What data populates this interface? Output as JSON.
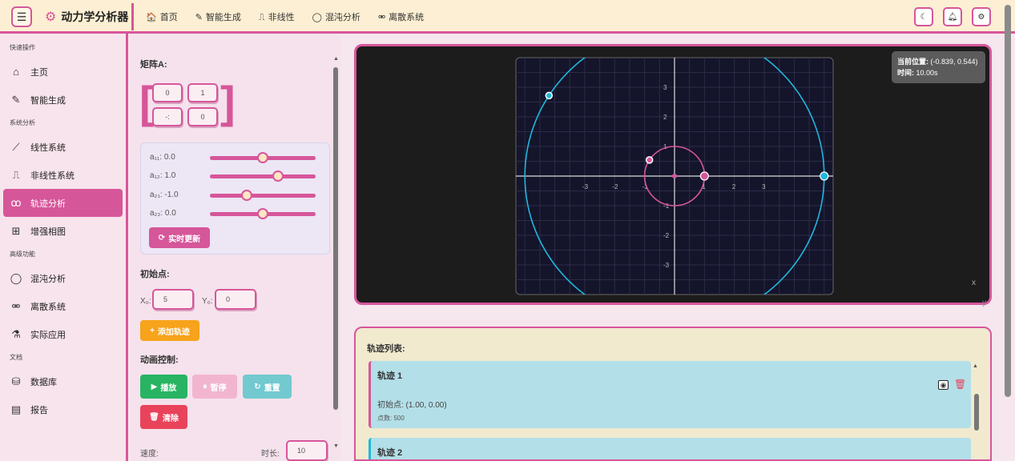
{
  "header": {
    "app_title": "动力学分析器",
    "nav": [
      {
        "label": "首页",
        "icon": "home-icon",
        "glyph": "🏠"
      },
      {
        "label": "智能生成",
        "icon": "pencil-icon",
        "glyph": "✎"
      },
      {
        "label": "非线性",
        "icon": "wave-icon",
        "glyph": "⎍"
      },
      {
        "label": "混沌分析",
        "icon": "circle-icon",
        "glyph": "◯"
      },
      {
        "label": "离散系统",
        "icon": "nodes-icon",
        "glyph": "⚮"
      }
    ]
  },
  "sidebar": {
    "sections": [
      {
        "title": "快速操作",
        "items": [
          {
            "label": "主页",
            "icon": "home-icon",
            "glyph": "⌂"
          },
          {
            "label": "智能生成",
            "icon": "pencil-icon",
            "glyph": "✎"
          }
        ]
      },
      {
        "title": "系统分析",
        "items": [
          {
            "label": "线性系统",
            "icon": "chart-line-icon",
            "glyph": "⟋"
          },
          {
            "label": "非线性系统",
            "icon": "wave-icon",
            "glyph": "⎍"
          },
          {
            "label": "轨迹分析",
            "icon": "route-icon",
            "glyph": "ꝏ",
            "active": true
          },
          {
            "label": "增强相图",
            "icon": "grid-icon",
            "glyph": "⊞"
          }
        ]
      },
      {
        "title": "高级功能",
        "items": [
          {
            "label": "混沌分析",
            "icon": "circle-icon",
            "glyph": "◯"
          },
          {
            "label": "离散系统",
            "icon": "nodes-icon",
            "glyph": "⚮"
          },
          {
            "label": "实际应用",
            "icon": "flask-icon",
            "glyph": "⚗"
          }
        ]
      },
      {
        "title": "文档",
        "items": [
          {
            "label": "数据库",
            "icon": "database-icon",
            "glyph": "⛁"
          },
          {
            "label": "报告",
            "icon": "file-icon",
            "glyph": "▤"
          }
        ]
      }
    ]
  },
  "controls": {
    "matrix_label": "矩阵A:",
    "matrix": [
      "0",
      "1",
      "-:",
      "0"
    ],
    "sliders": [
      {
        "label": "a₁₁: 0.0",
        "value": 0.0
      },
      {
        "label": "a₁₂: 1.0",
        "value": 1.0
      },
      {
        "label": "a₂₁: -1.0",
        "value": -1.0
      },
      {
        "label": "a₂₂: 0.0",
        "value": 0.0
      }
    ],
    "realtime_button": "实时更新",
    "initial_label": "初始点:",
    "x0_label": "X₀:",
    "x0_value": "5",
    "y0_label": "Y₀:",
    "y0_value": "0",
    "add_button": "添加轨迹",
    "anim_label": "动画控制:",
    "play": "播放",
    "pause": "暂停",
    "reset": "重置",
    "clear": "清除",
    "speed_label": "速度:",
    "duration_label": "时长:",
    "duration_value": "10"
  },
  "plot": {
    "tooltip_pos_label": "当前位置:",
    "tooltip_pos_value": "(-0.839, 0.544)",
    "tooltip_time_label": "时间:",
    "tooltip_time_value": "10.00s",
    "x_axis_letter": "x",
    "y_axis_letter": "y",
    "colors": {
      "trajectory1": "#d6569a",
      "trajectory2": "#1fb8dd",
      "plot_bg": "#14142b"
    }
  },
  "chart_data": {
    "type": "line",
    "xlim": [
      -5.3,
      5.3
    ],
    "ylim": [
      -4,
      4
    ],
    "x_ticks": [
      "-3",
      "-2",
      "-1",
      "1",
      "2",
      "3"
    ],
    "y_ticks": [
      "3",
      "2",
      "1",
      "-1",
      "-2",
      "-3"
    ],
    "grid": true,
    "series": [
      {
        "radius": 1,
        "start": [
          1,
          0
        ],
        "current": [
          -0.839,
          0.544
        ],
        "color": "#d6569a"
      },
      {
        "radius": 5,
        "start": [
          5,
          0
        ],
        "current": [
          -4.195,
          2.72
        ],
        "color": "#1fb8dd"
      }
    ]
  },
  "trajectory_list": {
    "title": "轨迹列表:",
    "items": [
      {
        "name": "轨迹 1",
        "initial": "初始点: (1.00, 0.00)",
        "points": "点数: 500"
      },
      {
        "name": "轨迹 2"
      }
    ]
  }
}
